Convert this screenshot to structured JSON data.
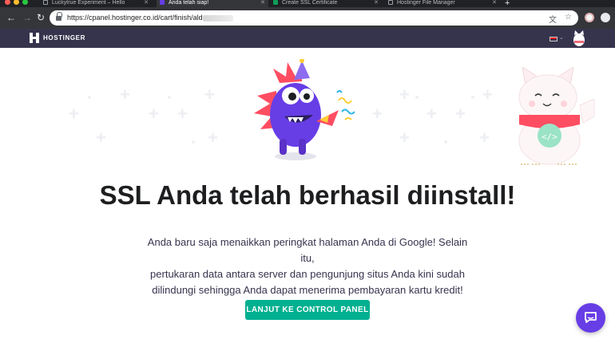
{
  "browser": {
    "tabs": [
      {
        "label": "Luckytrue Experiment – Hello"
      },
      {
        "label": "Anda telah siap!"
      },
      {
        "label": "Create SSL Certificate"
      },
      {
        "label": "Hostinger File Manager"
      }
    ],
    "new_tab_label": "+",
    "url": "https://cpanel.hostinger.co.id/cart/finish/ald",
    "icons": [
      "back-icon",
      "forward-icon",
      "reload-icon",
      "lock-icon",
      "translate-icon",
      "star-icon"
    ]
  },
  "site": {
    "brand": "HOSTINGER",
    "language_flag": "indonesia-flag",
    "colors": {
      "header": "#36344d",
      "accent": "#673de6",
      "button": "#00b090"
    }
  },
  "hero": {
    "headline": "SSL Anda telah berhasil diinstall!",
    "description_lines": [
      "Anda baru saja menaikkan peringkat halaman Anda di Google! Selain itu,",
      "pertukaran data antara server dan pengunjung situs Anda kini sudah",
      "dilindungi sehingga Anda dapat menerima pembayaran kartu kredit!"
    ],
    "cta_label": "LANJUT KE CONTROL PANEL",
    "cat_code_symbol": "</>"
  },
  "chat": {
    "icon": "chat-bubble-icon"
  }
}
